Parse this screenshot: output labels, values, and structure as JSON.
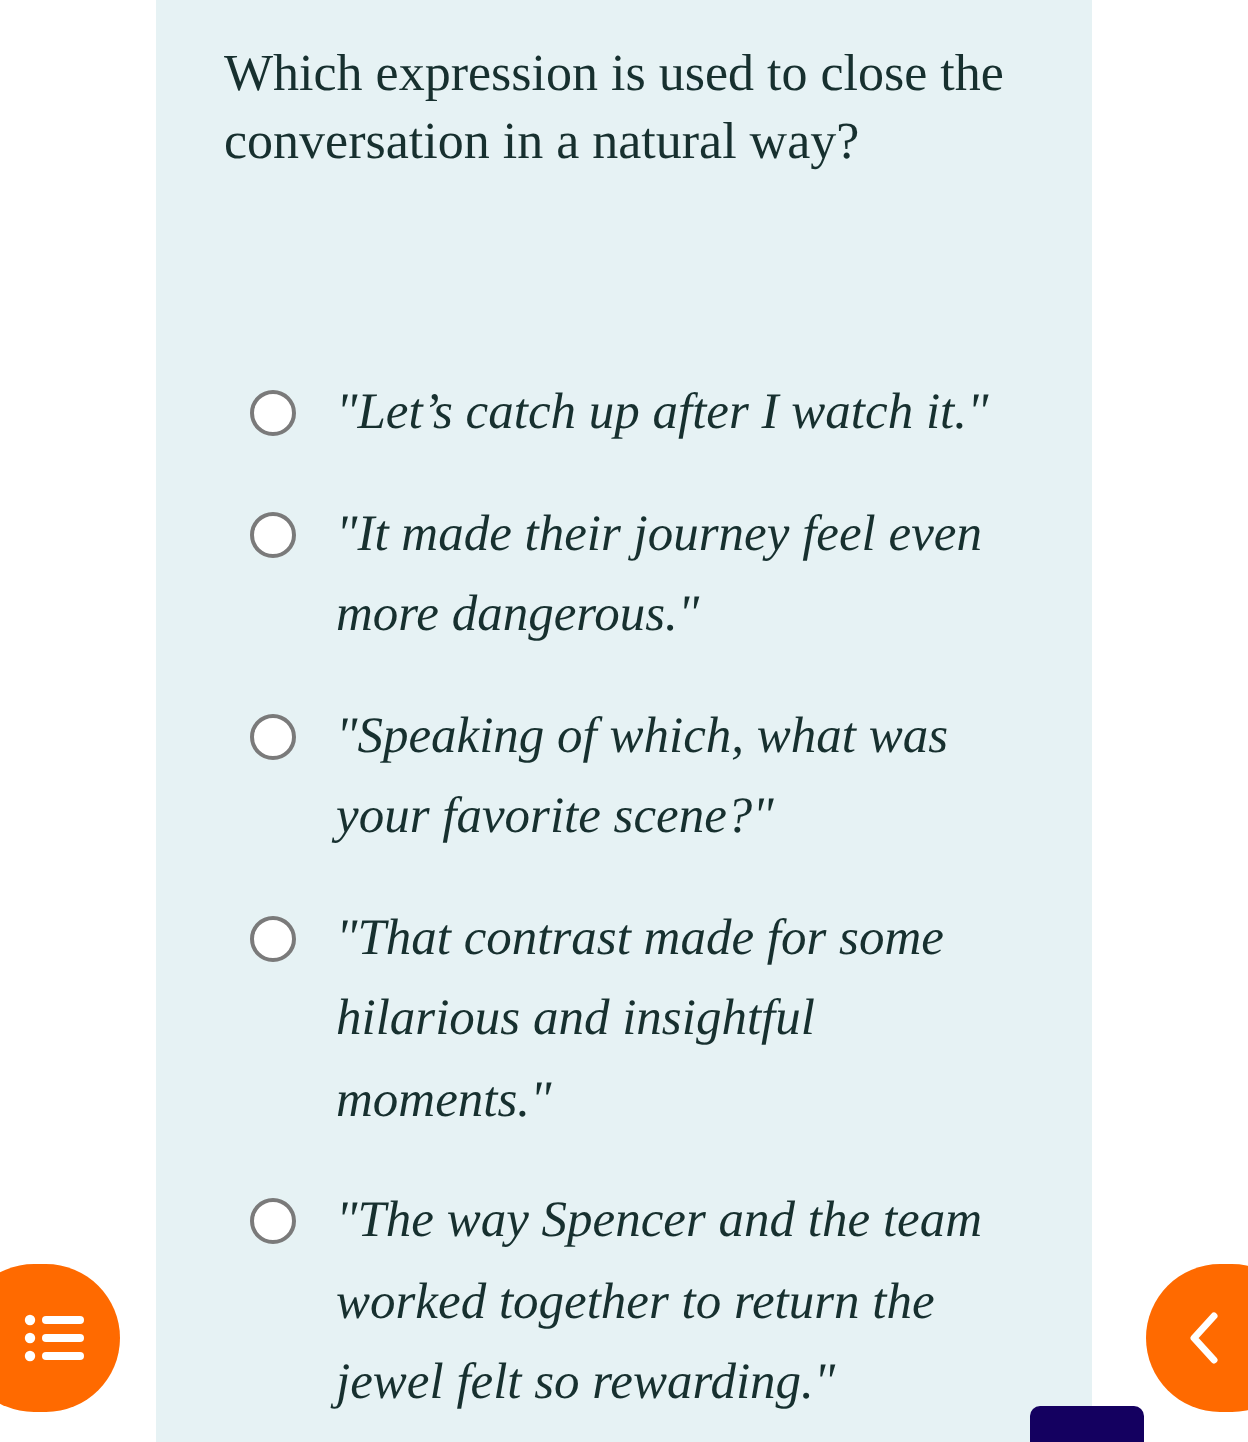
{
  "question": "Which expression is used to close the conversation in a natural way?",
  "options": [
    {
      "text": "\"Let’s catch up after I watch it.\"",
      "selected": false
    },
    {
      "text": "\"It made their journey feel even more dangerous.\"",
      "selected": false
    },
    {
      "text": "\"Speaking of which, what was your favorite scene?\"",
      "selected": false
    },
    {
      "text": "\"That contrast made for some hilarious and insightful moments.\"",
      "selected": false
    },
    {
      "text": "\"The way Spencer and the team worked together to return the jewel felt so rewarding.\"",
      "selected": false
    }
  ]
}
